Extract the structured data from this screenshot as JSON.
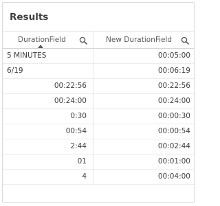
{
  "title": "Results",
  "columns": [
    {
      "label": "DurationField",
      "sorted": "ascending"
    },
    {
      "label": "New DurationField"
    }
  ],
  "rows": [
    {
      "duration": "5 MINUTES",
      "align": "left",
      "new_duration": "00:05:00"
    },
    {
      "duration": "6/19",
      "align": "left",
      "new_duration": "00:06:19"
    },
    {
      "duration": "00:22:56",
      "align": "right",
      "new_duration": "00:22:56"
    },
    {
      "duration": "00:24:00",
      "align": "right",
      "new_duration": "00:24:00"
    },
    {
      "duration": "0:30",
      "align": "right",
      "new_duration": "00:00:30"
    },
    {
      "duration": "00:54",
      "align": "right",
      "new_duration": "00:00:54"
    },
    {
      "duration": "2:44",
      "align": "right",
      "new_duration": "00:02:44"
    },
    {
      "duration": "01",
      "align": "right",
      "new_duration": "00:01:00"
    },
    {
      "duration": "4",
      "align": "right",
      "new_duration": "00:04:00"
    }
  ],
  "icons": {
    "search": "search-icon",
    "sort": "sort-ascending-icon"
  },
  "colors": {
    "text": "#404040",
    "border": "#d9d9d9"
  }
}
